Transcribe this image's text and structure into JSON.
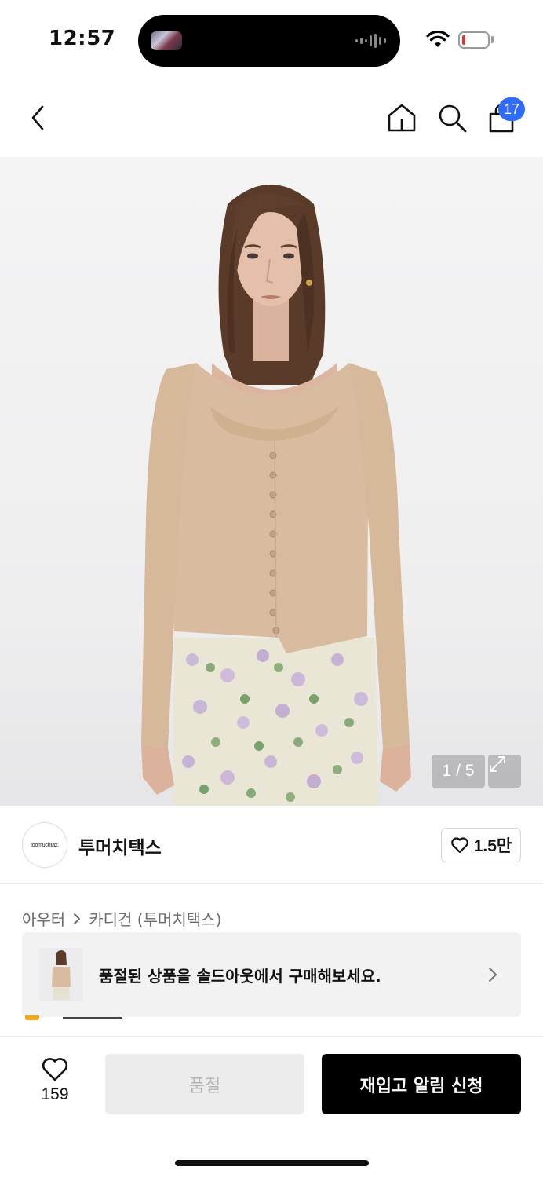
{
  "status_bar": {
    "time": "12:57",
    "battery_color": "#e5322d"
  },
  "nav": {
    "icons": {
      "back": "chevron-left-icon",
      "home": "home-icon",
      "search": "search-icon",
      "cart": "shopping-bag-icon"
    },
    "cart_badge": "17",
    "badge_color": "#2f6bff"
  },
  "hero": {
    "image_counter": "1 / 5",
    "expand_icon": "expand-icon"
  },
  "brand": {
    "logo_text": "toomuchtax.",
    "name": "투머치택스",
    "like_count": "1.5만"
  },
  "breadcrumb": {
    "items": [
      "아우터",
      "카디건 (투머치택스)"
    ]
  },
  "soldout_banner": {
    "text": "품절된 상품을 솔드아웃에서 구매해보세요."
  },
  "bottom_bar": {
    "wishlist_count": "159",
    "soldout_label": "품절",
    "restock_label": "재입고 알림 신청"
  }
}
